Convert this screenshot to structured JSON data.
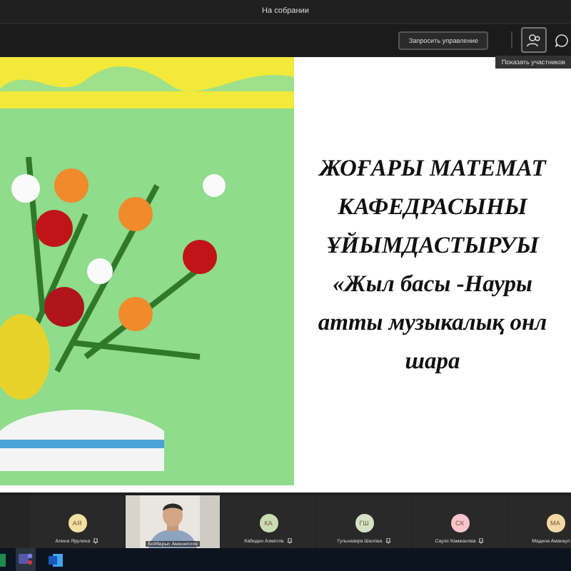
{
  "window": {
    "title": "На собрании"
  },
  "toolbar": {
    "request_control_button": "Запросить управление",
    "tooltip": "Показать участников"
  },
  "slide": {
    "lines": [
      "ЖОҒАРЫ МАТЕМАТ",
      "КАФЕДРАСЫНЫ",
      "ҰЙЫМДАСТЫРУЫ",
      "«Жыл басы -Науры",
      "атты музыкалық онл",
      "шара"
    ]
  },
  "participants": [
    {
      "kind": "avatar",
      "initials": "АЯ",
      "name": "Алина Ярулина",
      "color": "#f3dfa0"
    },
    {
      "kind": "video",
      "name": "Бейбарыс Аманжолов"
    },
    {
      "kind": "avatar",
      "initials": "КА",
      "name": "Кабидин Ахметов",
      "color": "#c9ddb4"
    },
    {
      "kind": "avatar",
      "initials": "ГШ",
      "name": "Гульназира Шалова",
      "color": "#d3e2c6"
    },
    {
      "kind": "avatar",
      "initials": "СК",
      "name": "Сауле Камжанова",
      "color": "#f6c4ca"
    },
    {
      "kind": "avatar",
      "initials": "МА",
      "name": "Мадина Аманкул",
      "color": "#f4d8a4"
    }
  ]
}
